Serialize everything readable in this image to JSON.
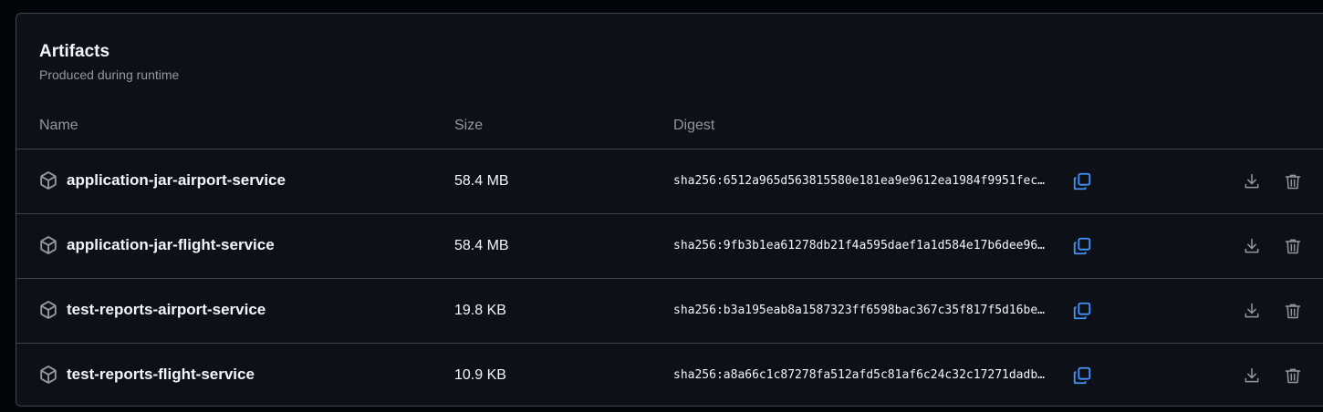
{
  "artifacts": {
    "title": "Artifacts",
    "subtitle": "Produced during runtime",
    "columns": {
      "name": "Name",
      "size": "Size",
      "digest": "Digest"
    },
    "rows": [
      {
        "name": "application-jar-airport-service",
        "size": "58.4 MB",
        "digest": "sha256:6512a965d563815580e181ea9e9612ea1984f9951fec…"
      },
      {
        "name": "application-jar-flight-service",
        "size": "58.4 MB",
        "digest": "sha256:9fb3b1ea61278db21f4a595daef1a1d584e17b6dee96…"
      },
      {
        "name": "test-reports-airport-service",
        "size": "19.8 KB",
        "digest": "sha256:b3a195eab8a1587323ff6598bac367c35f817f5d16be…"
      },
      {
        "name": "test-reports-flight-service",
        "size": "10.9 KB",
        "digest": "sha256:a8a66c1c87278fa512afd5c81af6c24c32c17271dadb…"
      }
    ],
    "icons": {
      "package": "package-icon",
      "copy": "copy-icon",
      "download": "download-icon",
      "delete": "trash-icon"
    },
    "colors": {
      "background": "#0d1117",
      "border": "#3d444d",
      "muted_text": "#9198a1",
      "text": "#f0f6fc",
      "accent": "#4493f8"
    }
  }
}
